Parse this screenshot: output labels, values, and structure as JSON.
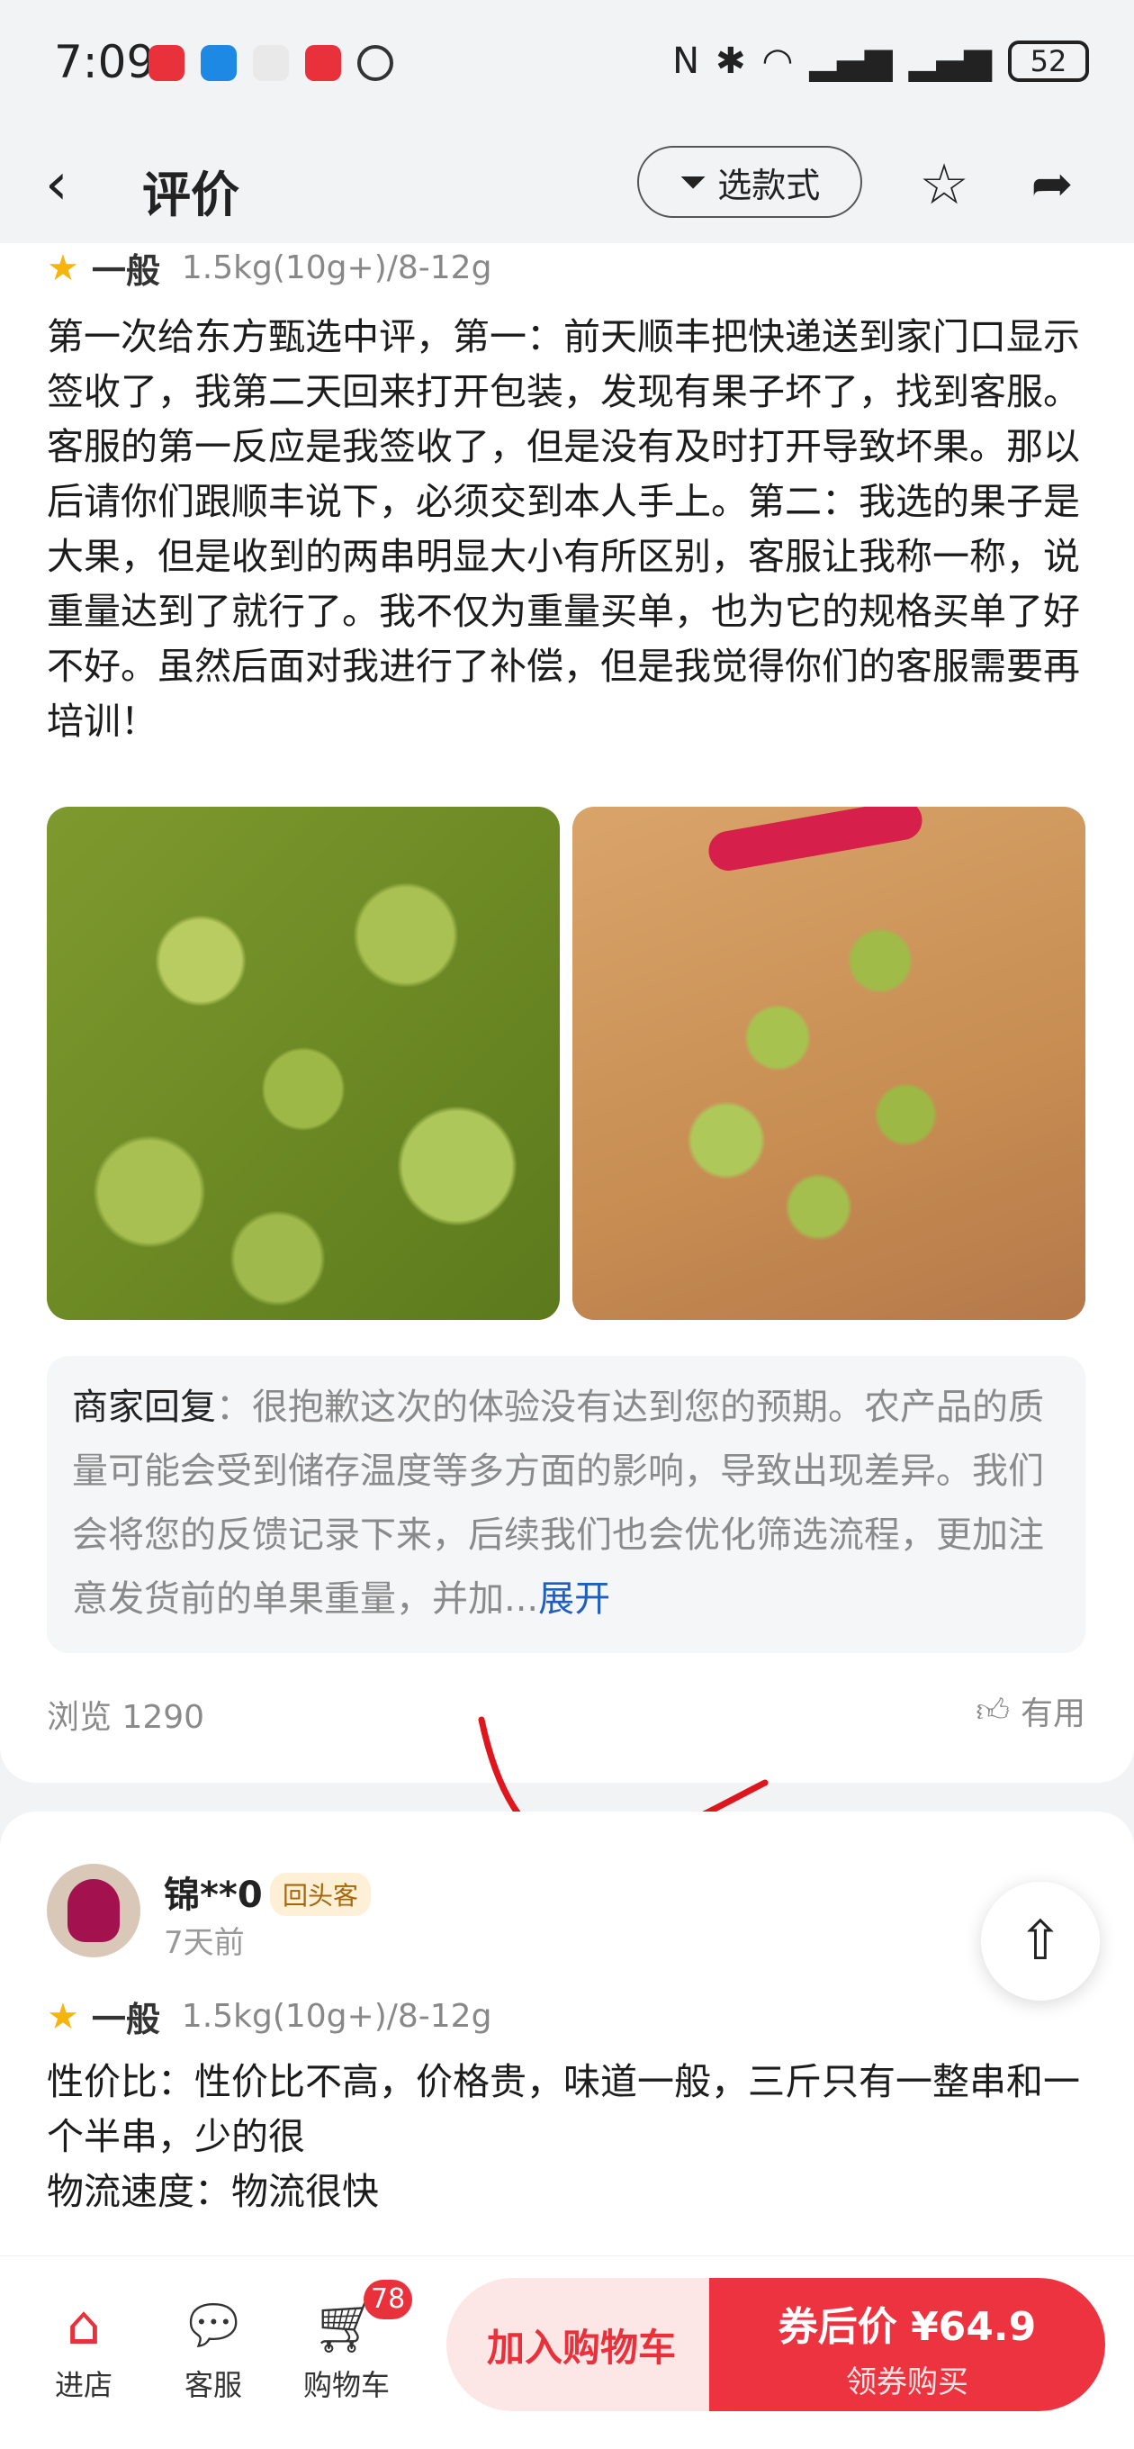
{
  "status_bar": {
    "time": "7:09",
    "battery": "52"
  },
  "header": {
    "title": "评价",
    "filter_label": "选款式"
  },
  "review1": {
    "rating_level": "一般",
    "spec": "1.5kg(10g+)/8-12g",
    "text": "第一次给东方甄选中评，第一：前天顺丰把快递送到家门口显示签收了，我第二天回来打开包装，发现有果子坏了，找到客服。客服的第一反应是我签收了，但是没有及时打开导致坏果。那以后请你们跟顺丰说下，必须交到本人手上。第二：我选的果子是大果，但是收到的两串明显大小有所区别，客服让我称一称，说重量达到了就行了。我不仅为重量买单，也为它的规格买单了好不好。虽然后面对我进行了补偿，但是我觉得你们的客服需要再培训！",
    "reply_label": "商家回复",
    "reply_text": "：很抱歉这次的体验没有达到您的预期。农产品的质量可能会受到储存温度等多方面的影响，导致出现差异。我们会将您的反馈记录下来，后续我们也会优化筛选流程，更加注意发货前的单果重量，并加...",
    "reply_expand": "展开",
    "views": "浏览 1290",
    "useful": "有用"
  },
  "review2": {
    "username": "锦**0",
    "badge": "回头客",
    "time_ago": "7天前",
    "rating_level": "一般",
    "spec": "1.5kg(10g+)/8-12g",
    "text_line1": "性价比：性价比不高，价格贵，味道一般，三斤只有一整串和一个半串，少的很",
    "text_line2": "物流速度：物流很快"
  },
  "bottom_bar": {
    "store": "进店",
    "service": "客服",
    "cart": "购物车",
    "cart_count": "78",
    "add_cart": "加入购物车",
    "price": "券后价 ¥64.9",
    "buy_sub": "领券购买"
  },
  "colors": {
    "accent_red": "#ee3340",
    "link_blue": "#1f5fbf"
  }
}
